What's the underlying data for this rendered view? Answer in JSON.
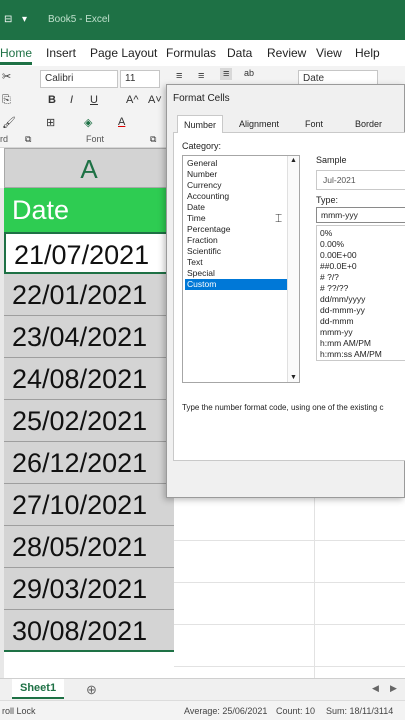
{
  "titlebar": {
    "qa_items": [
      "⊟",
      "▾"
    ],
    "title": "Book5 - Excel"
  },
  "ribbon_tabs": [
    "Home",
    "Insert",
    "Page Layout",
    "Formulas",
    "Data",
    "Review",
    "View",
    "Help"
  ],
  "ribbon": {
    "font_name": "Calibri",
    "font_size": "11",
    "number_format": "Date",
    "font_group_label": "Font",
    "clipboard_label": "rd",
    "bold": "B",
    "italic": "I",
    "underline": "U",
    "grow_font": "A^",
    "shrink_font": "A˅",
    "font_color": "A",
    "ab_label": "ab\nc",
    "accent_color": "#1e7145"
  },
  "sheet": {
    "column_header": "A",
    "header_cell": "Date",
    "dates": [
      "21/07/2021",
      "22/01/2021",
      "23/04/2021",
      "24/08/2021",
      "25/02/2021",
      "26/12/2021",
      "27/10/2021",
      "28/05/2021",
      "29/03/2021",
      "30/08/2021"
    ]
  },
  "dialog": {
    "title": "Format Cells",
    "tabs": [
      "Number",
      "Alignment",
      "Font",
      "Border"
    ],
    "category_label": "Category:",
    "categories": [
      "General",
      "Number",
      "Currency",
      "Accounting",
      "Date",
      "Time",
      "Percentage",
      "Fraction",
      "Scientific",
      "Text",
      "Special",
      "Custom"
    ],
    "selected_category": "Custom",
    "sample_label": "Sample",
    "sample_value": "Jul-2021",
    "type_label": "Type:",
    "type_value": "mmm-yyy",
    "formats": [
      "0%",
      "0.00%",
      "0.00E+00",
      "##0.0E+0",
      "# ?/?",
      "# ??/??",
      "dd/mm/yyyy",
      "dd-mmm-yy",
      "dd-mmm",
      "mmm-yy",
      "h:mm AM/PM",
      "h:mm:ss AM/PM"
    ],
    "hint": "Type the number format code, using one of the existing c"
  },
  "sheet_tabs": {
    "active": "Sheet1",
    "add": "⊕"
  },
  "status": {
    "scroll_lock": "roll Lock",
    "average": "Average: 25/06/2021",
    "count": "Count: 10",
    "sum": "Sum: 18/11/3114"
  }
}
